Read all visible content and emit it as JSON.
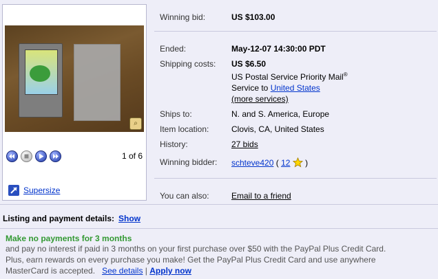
{
  "gallery": {
    "counter": "1 of 6",
    "supersize_label": "Supersize",
    "controls": [
      "prev-icon",
      "stop-icon",
      "play-icon",
      "next-icon"
    ],
    "zoom_badge": "zoom-icon"
  },
  "details": {
    "winning_bid": {
      "label": "Winning bid:",
      "value": "US $103.00"
    },
    "ended": {
      "label": "Ended:",
      "value": "May-12-07 14:30:00 PDT"
    },
    "shipping": {
      "label": "Shipping costs:",
      "value": "US $6.50",
      "service_line": "US Postal Service Priority Mail",
      "service_mark": "®",
      "service_to_prefix": "Service to ",
      "service_to_link": "United States",
      "more_services": "(more services)"
    },
    "ships_to": {
      "label": "Ships to:",
      "value": "N. and S. America, Europe"
    },
    "item_location": {
      "label": "Item location:",
      "value": "Clovis, CA, United States"
    },
    "history": {
      "label": "History:",
      "value": "27 bids"
    },
    "winning_bidder": {
      "label": "Winning bidder:",
      "username": "schteve420",
      "open_paren": " ( ",
      "feedback_score": "12",
      "close_paren": " )"
    },
    "you_can_also": {
      "label": "You can also:",
      "value": "Email to a friend"
    }
  },
  "listing": {
    "label": "Listing and payment details:",
    "show_link": "Show"
  },
  "promo": {
    "title": "Make no payments for 3 months",
    "line1": "and pay no interest if paid in 3 months on your first purchase over $50 with the PayPal Plus Credit Card.",
    "line2": "Plus, earn rewards on every purchase you make! Get the PayPal Plus Credit Card and use anywhere",
    "line3_prefix": "MasterCard is accepted.",
    "see_details": "See details",
    "divider": "|",
    "apply_now": "Apply now"
  },
  "colors": {
    "background": "#eeeef8",
    "link": "#0033cc",
    "promo_green": "#339933",
    "separator": "#c9c9dd"
  }
}
